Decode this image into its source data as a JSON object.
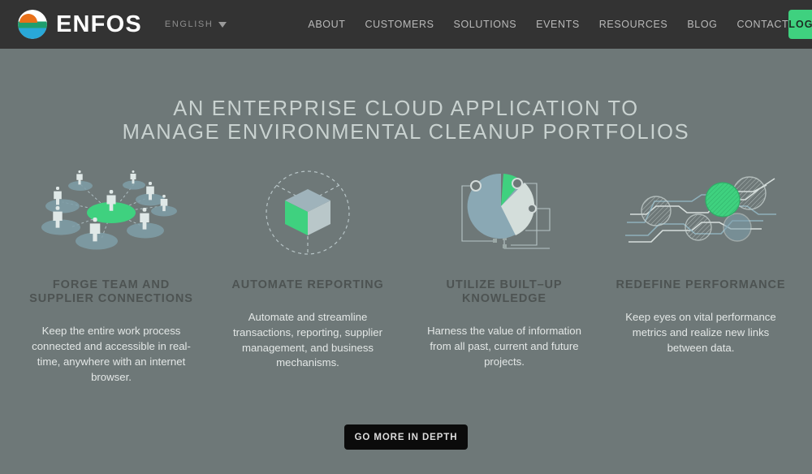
{
  "header": {
    "logo_icon": "enfos-circle-logo-icon",
    "wordmark": "ENFOS",
    "language": {
      "label": "ENGLISH",
      "caret_icon": "chevron-down-icon"
    },
    "nav": [
      {
        "label": "ABOUT"
      },
      {
        "label": "CUSTOMERS"
      },
      {
        "label": "SOLUTIONS"
      },
      {
        "label": "EVENTS"
      },
      {
        "label": "RESOURCES"
      },
      {
        "label": "BLOG"
      },
      {
        "label": "CONTACT"
      }
    ],
    "login_label": "LOGIN"
  },
  "hero": {
    "headline_line1": "AN ENTERPRISE CLOUD APPLICATION TO",
    "headline_line2": "MANAGE ENVIRONMENTAL CLEANUP PORTFOLIOS"
  },
  "features": [
    {
      "icon": "people-network-icon",
      "title": "FORGE TEAM AND SUPPLIER CONNECTIONS",
      "body": "Keep the entire work process connected and accessible in real-time, anywhere with an internet browser."
    },
    {
      "icon": "isometric-cube-icon",
      "title": "AUTOMATE REPORTING",
      "body": "Automate and streamline transactions, reporting, supplier management, and business mechanisms."
    },
    {
      "icon": "pie-chart-circuit-icon",
      "title": "UTILIZE BUILT–UP KNOWLEDGE",
      "body": "Harness the value of information from all past, current and future projects."
    },
    {
      "icon": "data-links-nodes-icon",
      "title": "REDEFINE PERFORMANCE",
      "body": "Keep eyes on vital performance metrics and realize new links between data."
    }
  ],
  "cta": {
    "label": "GO MORE IN DEPTH"
  },
  "colors": {
    "header_bg": "#333333",
    "page_bg": "#6e7878",
    "accent_green": "#3fd17f",
    "headline": "#c9d2d0",
    "heading": "#4d5352",
    "body_text": "#e3e7e6",
    "cta_bg": "#0b0b0b",
    "logo_orange": "#e8701a",
    "logo_green": "#1f9e6e",
    "logo_blue": "#29a8d8"
  }
}
